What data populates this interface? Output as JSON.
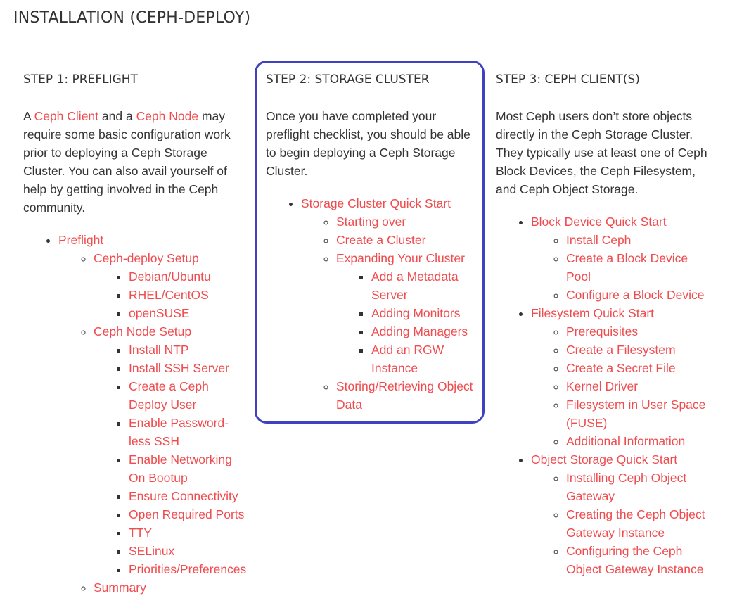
{
  "page": {
    "title": "INSTALLATION (CEPH-DEPLOY)"
  },
  "colors": {
    "link": "#ef4c4f",
    "text": "#333333",
    "highlight_border": "#3e42c0"
  },
  "step1": {
    "heading": "STEP 1: PREFLIGHT",
    "intro": {
      "t1": "A ",
      "link1": "Ceph Client",
      "t2": " and a ",
      "link2": "Ceph Node",
      "t3": " may require some basic configuration work prior to deploying a Ceph Storage Cluster. You can also avail yourself of help by getting involved in the Ceph community."
    },
    "preflight": "Preflight",
    "deploy_setup": "Ceph-deploy Setup",
    "deploy_items": [
      "Debian/Ubuntu",
      "RHEL/CentOS",
      "openSUSE"
    ],
    "node_setup": "Ceph Node Setup",
    "node_items": [
      "Install NTP",
      "Install SSH Server",
      "Create a Ceph Deploy User",
      "Enable Password-less SSH",
      "Enable Networking On Bootup",
      "Ensure Connectivity",
      "Open Required Ports",
      "TTY",
      "SELinux",
      "Priorities/Preferences"
    ],
    "summary": "Summary"
  },
  "step2": {
    "heading": "STEP 2: STORAGE CLUSTER",
    "intro": "Once you have completed your preflight checklist, you should be able to begin deploying a Ceph Storage Cluster.",
    "quick_start": "Storage Cluster Quick Start",
    "starting_over": "Starting over",
    "create_cluster": "Create a Cluster",
    "expanding": "Expanding Your Cluster",
    "expanding_items": [
      "Add a Metadata Server",
      "Adding Monitors",
      "Adding Managers",
      "Add an RGW Instance"
    ],
    "storing": "Storing/Retrieving Object Data"
  },
  "step3": {
    "heading": "STEP 3: CEPH CLIENT(S)",
    "intro": "Most Ceph users don’t store objects directly in the Ceph Storage Cluster. They typically use at least one of Ceph Block Devices, the Ceph Filesystem, and Ceph Object Storage.",
    "block": "Block Device Quick Start",
    "block_items": [
      "Install Ceph",
      "Create a Block Device Pool",
      "Configure a Block Device"
    ],
    "fs": "Filesystem Quick Start",
    "fs_items": [
      "Prerequisites",
      "Create a Filesystem",
      "Create a Secret File",
      "Kernel Driver",
      "Filesystem in User Space (FUSE)",
      "Additional Information"
    ],
    "object": "Object Storage Quick Start",
    "object_items": [
      "Installing Ceph Object Gateway",
      "Creating the Ceph Object Gateway Instance",
      "Configuring the Ceph Object Gateway Instance"
    ]
  }
}
